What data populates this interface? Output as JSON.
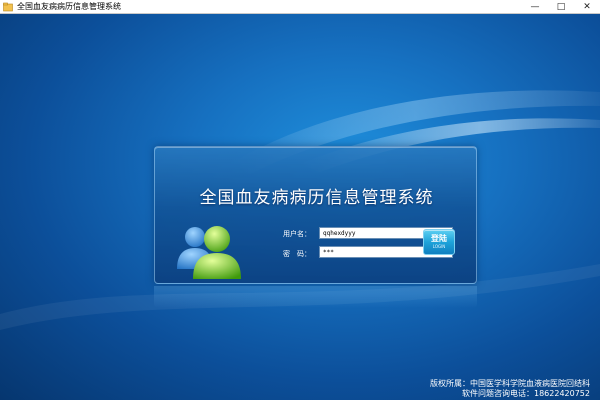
{
  "window": {
    "title": "全国血友病病历信息管理系统",
    "minimize_glyph": "—",
    "maximize_glyph": "□",
    "close_glyph": "✕"
  },
  "login": {
    "title": "全国血友病病历信息管理系统",
    "username_label": "用户名：",
    "username_value": "qqhexdyyy",
    "password_label": "密　码：",
    "password_value": "***",
    "login_button_label": "登陆",
    "login_button_sublabel": "LOGIN"
  },
  "footer": {
    "copyright": "版权所属：中国医学科学院血液病医院回结科",
    "support": "软件问题咨询电话：18622420752"
  },
  "icons": {
    "app": "app-icon",
    "users": "users-icon"
  },
  "colors": {
    "background": "#0c4f9a",
    "accent": "#1ea3da",
    "user_green": "#6cc21c",
    "user_blue": "#3a8fd6"
  }
}
